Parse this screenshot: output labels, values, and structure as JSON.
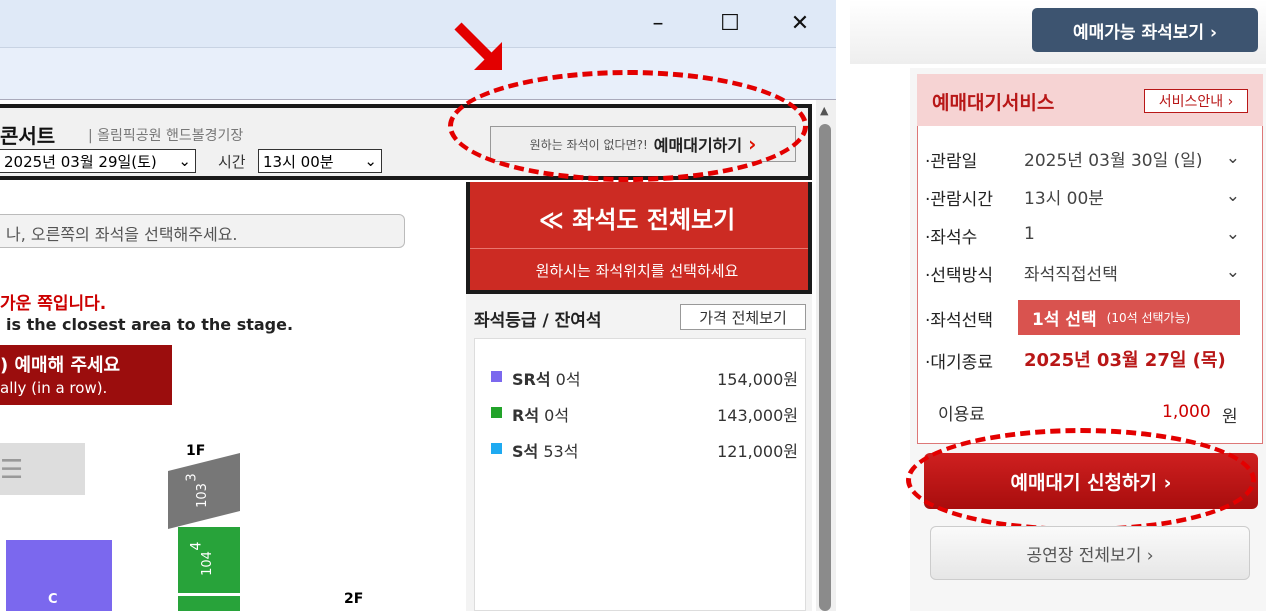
{
  "window": {
    "minimize": "–",
    "maximize": "☐",
    "close": "✕"
  },
  "concert": {
    "title": "콘서트",
    "venue": "| 올림픽공원 핸드볼경기장",
    "date": "2025년 03월 29일(토)",
    "time_label": "시간",
    "time_value": "13시 00분"
  },
  "waitlist_button": {
    "prefix": "원하는 좌석이 없다면?!",
    "label": "예매대기하기",
    "arrow": "›"
  },
  "seatmap_banner": {
    "title": "≪ 좌석도 전체보기",
    "subtitle": "원하시는 좌석위치를 선택하세요"
  },
  "left": {
    "instruction": "나, 오른쪽의 좌석을 선택해주세요.",
    "notice_ko": "가운 쪽입니다.",
    "notice_en": "is the closest area to the stage.",
    "warn_ko": ") 예매해 주세요",
    "warn_en": "ally (in a row).",
    "floor1": "1F",
    "floor2": "2F",
    "block3": "3",
    "block103": "103",
    "block4": "4",
    "block104": "104",
    "blockC": "C"
  },
  "grades": {
    "title": "좌석등급 / 잔여석",
    "price_button": "가격 전체보기",
    "items": [
      {
        "name": "SR석",
        "remain": "0석",
        "price": "154,000원",
        "color": "#7b68ee"
      },
      {
        "name": "R석",
        "remain": "0석",
        "price": "143,000원",
        "color": "#22a32a"
      },
      {
        "name": "S석",
        "remain": "53석",
        "price": "121,000원",
        "color": "#1eaaf1"
      }
    ]
  },
  "panel": {
    "top_button": "예매가능 좌석보기 ›",
    "service_title": "예매대기서비스",
    "service_info": "서비스안내 ›",
    "rows": [
      {
        "label": "·관람일",
        "value": "2025년 03월 30일 (일)"
      },
      {
        "label": "·관람시간",
        "value": "13시 00분"
      },
      {
        "label": "·좌석수",
        "value": "1"
      },
      {
        "label": "·선택방식",
        "value": "좌석직접선택"
      }
    ],
    "seat_select_label": "·좌석선택",
    "seat_select_value": "1석 선택",
    "seat_select_note": "(10석 선택가능)",
    "end_label": "·대기종료",
    "end_value": "2025년 03월 27일 (목)",
    "fee_label": "이용료",
    "fee_value": "1,000",
    "fee_unit": "원",
    "apply_button": "예매대기 신청하기 ›",
    "venue_button": "공연장 전체보기 ›"
  }
}
